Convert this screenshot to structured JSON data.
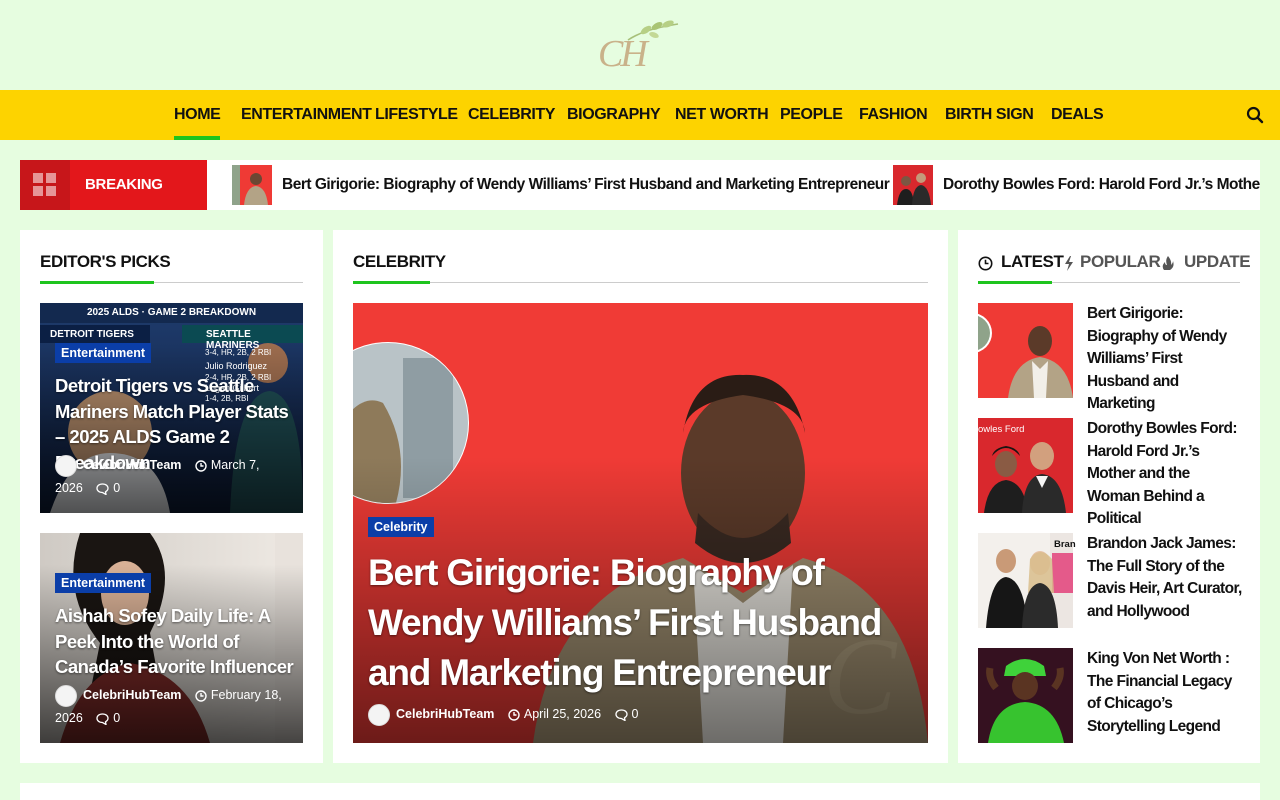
{
  "logo": {
    "text": "CH"
  },
  "nav": {
    "items": [
      "HOME",
      "ENTERTAINMENT",
      "LIFESTYLE",
      "CELEBRITY",
      "BIOGRAPHY",
      "NET WORTH",
      "PEOPLE",
      "FASHION",
      "BIRTH SIGN",
      "DEALS"
    ],
    "active_index": 0
  },
  "breaking": {
    "label": "BREAKING NEWS",
    "items": [
      "Bert Girigorie: Biography of Wendy Williams’ First Husband and Marketing Entrepreneur",
      "Dorothy Bowles Ford: Harold Ford Jr.’s Mother a"
    ]
  },
  "editors": {
    "title": "EDITOR'S PICKS",
    "cards": [
      {
        "category": "Entertainment",
        "title": "Detroit Tigers vs Seattle Mariners Match Player Stats – 2025 ALDS Game 2 Breakdown",
        "author": "CelebriHubTeam",
        "date": "March 7,",
        "date2": "2026",
        "comments": "0",
        "img_top": "2025 ALDS · GAME 2 BREAKDOWN",
        "img_left": "DETROIT TIGERS",
        "img_right": "SEATTLE MARINERS",
        "img_stat1": "3-4, HR, 2B, 2 RBI",
        "img_player": "Julio Rodriguez",
        "img_stat2": "2-4, HR, 2B, 2 RBI",
        "img_player2": "Logan Gilbert",
        "img_stat3": "1-4, 2B, RBI"
      },
      {
        "category": "Entertainment",
        "title": "Aishah Sofey Daily Life: A Peek Into the World of Canada’s Favorite Influencer",
        "author": "CelebriHubTeam",
        "date": "February 18,",
        "date2": "2026",
        "comments": "0"
      }
    ]
  },
  "celebrity": {
    "title": "CELEBRITY",
    "featured": {
      "category": "Celebrity",
      "title": "Bert Girigorie: Biography of Wendy Williams’ First Husband and Marketing Entrepreneur",
      "author": "CelebriHubTeam",
      "date": "April 25, 2026",
      "comments": "0"
    }
  },
  "sidebar": {
    "tabs": [
      "LATEST",
      "POPULAR",
      "UPDATE"
    ],
    "items": [
      "Bert Girigorie: Biography of Wendy Williams’ First Husband and Marketing",
      "Dorothy Bowles Ford: Harold Ford Jr.’s Mother and the Woman Behind a Political",
      "Brandon Jack James: The Full Story of the Davis Heir, Art Curator, and Hollywood",
      "King Von Net Worth : The Financial Legacy of Chicago’s Storytelling Legend"
    ],
    "thumb_label_2": "owles Ford",
    "thumb_label_3": "Bran"
  },
  "colors": {
    "background": "#e6fde0",
    "nav": "#fdd300",
    "accent": "#1ec41e",
    "breaking": "#e3171b",
    "badge": "#0b3ea8"
  }
}
